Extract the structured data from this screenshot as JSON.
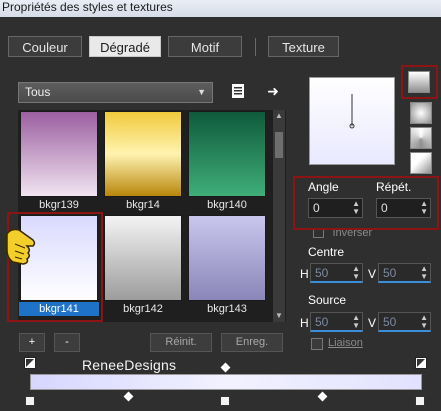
{
  "window": {
    "title": "Propriétés des styles et textures"
  },
  "tabs": [
    {
      "label": "Couleur",
      "active": false
    },
    {
      "label": "Dégradé",
      "active": true
    },
    {
      "label": "Motif",
      "active": false
    },
    {
      "label": "Texture",
      "active": false
    }
  ],
  "library": {
    "category": "Tous",
    "items": [
      {
        "label": "bkgr139",
        "colors": [
          "#9b5fa0",
          "#f1e4f1"
        ],
        "selected": false
      },
      {
        "label": "bkgr14",
        "colors": [
          "#f0c93c",
          "#b8860b"
        ],
        "selected": false
      },
      {
        "label": "bkgr140",
        "colors": [
          "#0f5a3b",
          "#3fae79"
        ],
        "selected": false
      },
      {
        "label": "bkgr141",
        "colors": [
          "#d9d9ff",
          "#ffffff"
        ],
        "selected": true
      },
      {
        "label": "bkgr142",
        "colors": [
          "#f4f4f4",
          "#9c9c9c"
        ],
        "selected": false
      },
      {
        "label": "bkgr143",
        "colors": [
          "#c9c6ee",
          "#8a87b8"
        ],
        "selected": false
      }
    ],
    "add_label": "+",
    "remove_label": "-",
    "reset_label": "Réinit.",
    "save_label": "Enreg."
  },
  "settings": {
    "angle_label": "Angle",
    "angle_value": "0",
    "repeat_label": "Répét.",
    "repeat_value": "0",
    "invert_label": "Inverser",
    "center_label": "Centre",
    "center_h": "50",
    "center_v": "50",
    "source_label": "Source",
    "source_h": "50",
    "source_v": "50",
    "h_label": "H",
    "v_label": "V",
    "link_label": "Liaison"
  },
  "watermark": "ReneeDesigns",
  "accent_color": "#1e73c8",
  "highlight_color": "#8c1414"
}
